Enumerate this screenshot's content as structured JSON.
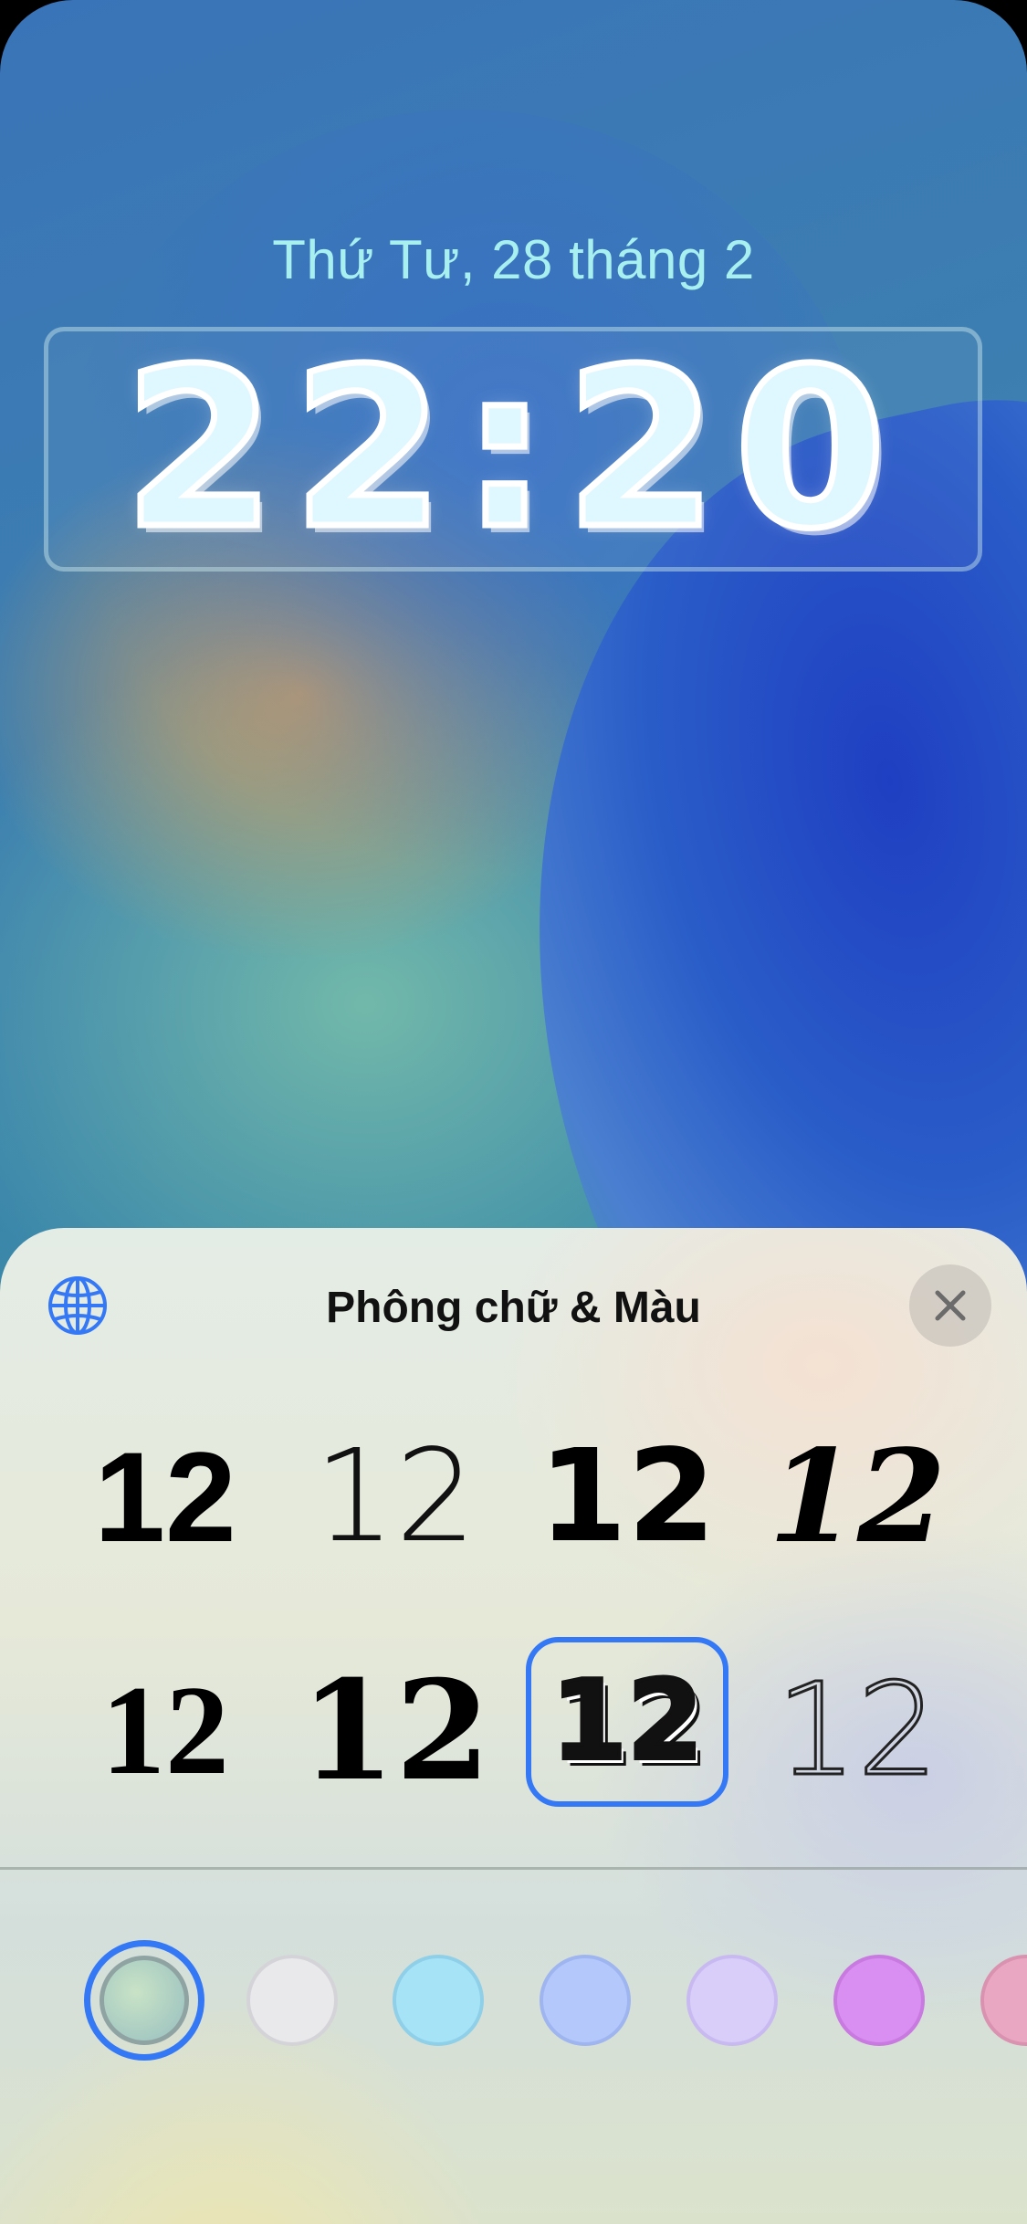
{
  "lockscreen": {
    "date": "Thứ Tư, 28 tháng 2",
    "time": "22:20"
  },
  "sheet": {
    "title": "Phông chữ & Màu",
    "globe_icon": "globe-icon",
    "close_icon": "close-icon",
    "font_options": [
      {
        "label": "12",
        "style": "rounded-bold"
      },
      {
        "label": "12",
        "style": "thin"
      },
      {
        "label": "12",
        "style": "bold-sans"
      },
      {
        "label": "12",
        "style": "italic-display"
      },
      {
        "label": "12",
        "style": "serif"
      },
      {
        "label": "12",
        "style": "heavy-serif"
      },
      {
        "label": "12",
        "style": "bubble",
        "selected": true
      },
      {
        "label": "12",
        "style": "outline-stencil"
      }
    ],
    "color_swatches": [
      {
        "color": "#a9cfc0",
        "selected": true
      },
      {
        "color": "#e9e9ec"
      },
      {
        "color": "#a6e3f7"
      },
      {
        "color": "#b4c8fb"
      },
      {
        "color": "#d9cef9"
      },
      {
        "color": "#d98ef1"
      },
      {
        "color": "#eaa7c2"
      }
    ]
  },
  "colors": {
    "accent": "#3478f6",
    "date_text": "#a8f0f0"
  }
}
